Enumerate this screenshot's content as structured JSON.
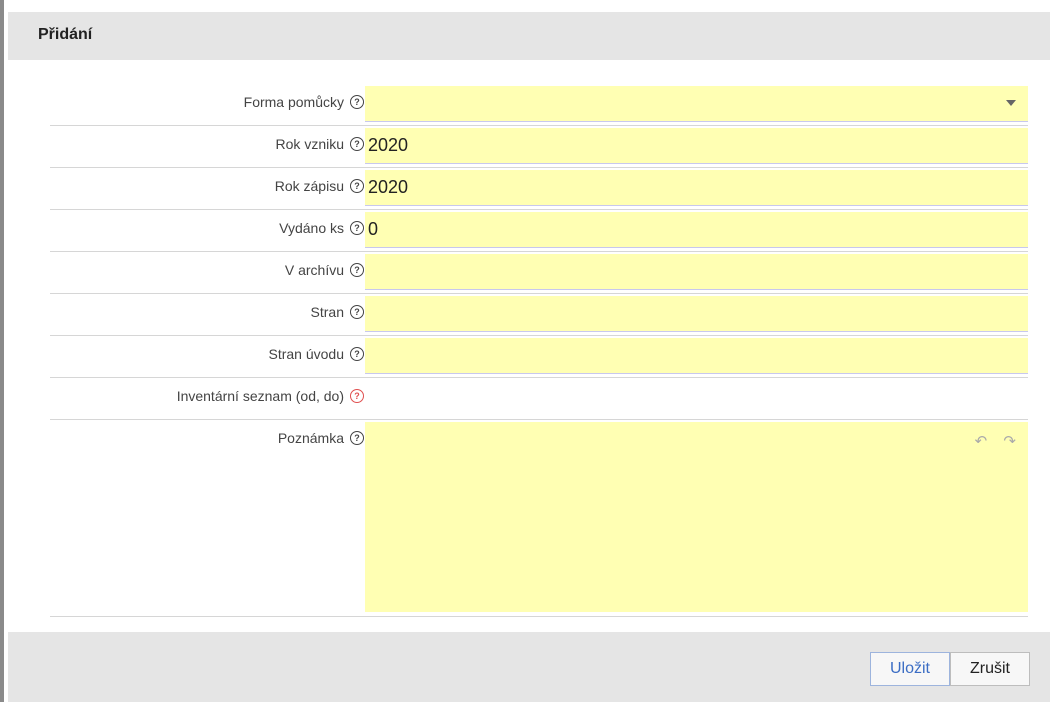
{
  "dialog": {
    "title": "Přidání",
    "save_label": "Uložit",
    "cancel_label": "Zrušit"
  },
  "fields": [
    {
      "label": "Forma pomůcky",
      "value": ""
    },
    {
      "label": "Rok vzniku",
      "value": "2020"
    },
    {
      "label": "Rok zápisu",
      "value": "2020"
    },
    {
      "label": "Vydáno ks",
      "value": "0"
    },
    {
      "label": "V archívu",
      "value": ""
    },
    {
      "label": "Stran",
      "value": ""
    },
    {
      "label": "Stran úvodu",
      "value": ""
    },
    {
      "label": "Inventární seznam (od, do)",
      "value": ""
    },
    {
      "label": "Poznámka",
      "value": ""
    }
  ],
  "icons": {
    "help": "?",
    "undo": "↶",
    "redo": "↷"
  },
  "colors": {
    "field_background": "#ffffb3",
    "header_background": "#e5e5e5",
    "save_text": "#3b6dc4",
    "required_help": "#e05050"
  }
}
